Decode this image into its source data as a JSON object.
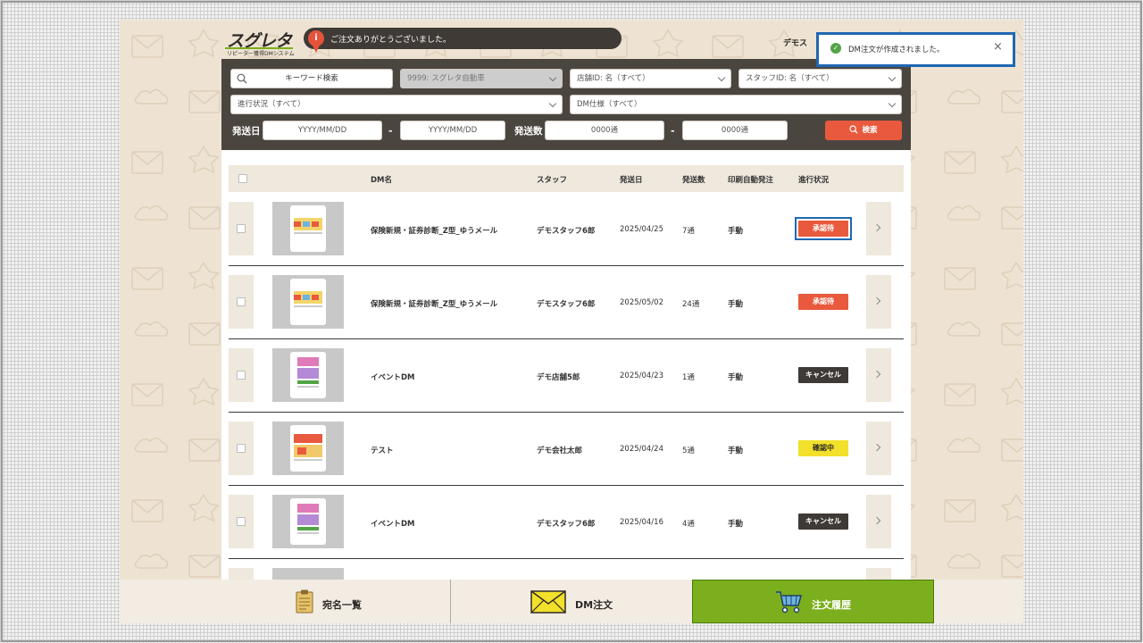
{
  "header": {
    "logo_main": "スグレタ",
    "logo_sub": "リピーター獲得DMシステム",
    "notice_icon": "i",
    "notice_text": "ご注文ありがとうございました。",
    "user_name": "デモス"
  },
  "toast": {
    "check_icon": "✓",
    "message": "DM注文が作成されました。",
    "close": "×"
  },
  "filters": {
    "keyword_label": "キーワード検索",
    "company": "9999: スグレタ自動車",
    "store": "店舗ID: 名（すべて）",
    "staff": "スタッフID: 名（すべて）",
    "status": "進行状況（すべて）",
    "dm_spec": "DM仕様（すべて）",
    "send_date_label": "発送日",
    "date_from": "YYYY/MM/DD",
    "date_to": "YYYY/MM/DD",
    "range_sep": "-",
    "count_label": "発送数",
    "count_from": "0000通",
    "count_to": "0000通",
    "search_button": "検索"
  },
  "table": {
    "headers": {
      "dm_name": "DM名",
      "staff": "スタッフ",
      "send_date": "発送日",
      "count": "発送数",
      "auto_print": "印刷自動発注",
      "status": "進行状況"
    },
    "rows": [
      {
        "dm_name": "保険新規・証券診断_Z型_ゆうメール",
        "staff": "デモスタッフ6郎",
        "send_date": "2025/04/25",
        "count": "7通",
        "auto_print": "手動",
        "status": "承認待"
      },
      {
        "dm_name": "保険新規・証券診断_Z型_ゆうメール",
        "staff": "デモスタッフ6郎",
        "send_date": "2025/05/02",
        "count": "24通",
        "auto_print": "手動",
        "status": "承認待"
      },
      {
        "dm_name": "イベントDM",
        "staff": "デモ店舗5郎",
        "send_date": "2025/04/23",
        "count": "1通",
        "auto_print": "手動",
        "status": "キャンセル"
      },
      {
        "dm_name": "テスト",
        "staff": "デモ会社太郎",
        "send_date": "2025/04/24",
        "count": "5通",
        "auto_print": "手動",
        "status": "確認中"
      },
      {
        "dm_name": "イベントDM",
        "staff": "デモスタッフ6郎",
        "send_date": "2025/04/16",
        "count": "4通",
        "auto_print": "手動",
        "status": "キャンセル"
      }
    ]
  },
  "bottom_nav": {
    "items": [
      {
        "label": "宛名一覧",
        "icon": "clipboard-icon"
      },
      {
        "label": "DM注文",
        "icon": "envelope-icon"
      },
      {
        "label": "注文履歴",
        "icon": "cart-icon"
      }
    ]
  },
  "colors": {
    "brand_green": "#7caf1d",
    "accent_orange": "#e8593d",
    "dark_panel": "#4b4540",
    "highlight_blue": "#1f67b2",
    "review_yellow": "#f2e02a"
  }
}
